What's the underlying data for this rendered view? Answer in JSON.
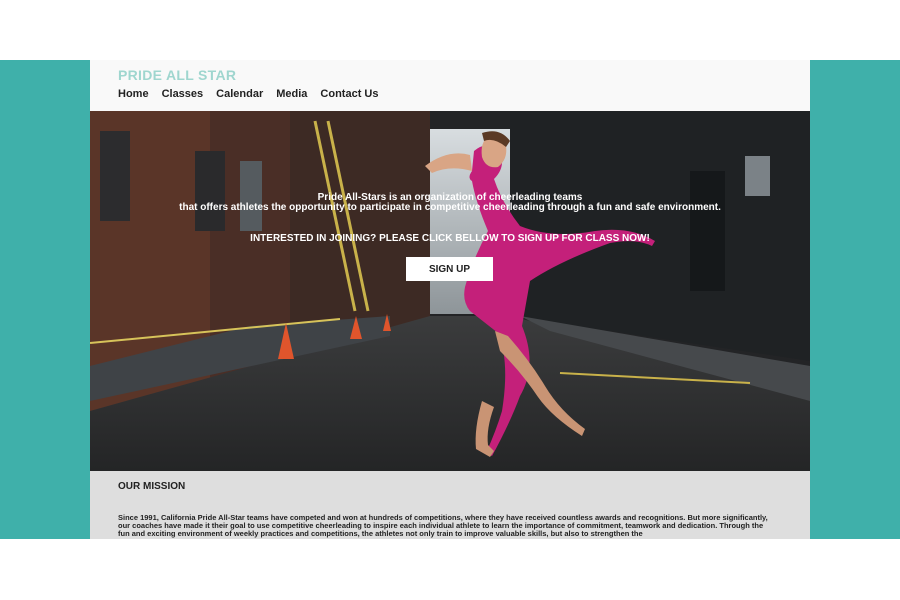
{
  "brand": "PRIDE ALL STAR",
  "nav": [
    "Home",
    "Classes",
    "Calendar",
    "Media",
    "Contact Us"
  ],
  "hero": {
    "line1": "Pride All-Stars is an organization of cheerleading teams",
    "line2": "that offers athletes the opportunity to participate in competitive cheerleading through a fun and safe environment.",
    "cta": "INTERESTED IN JOINING? PLEASE CLICK BELLOW TO SIGN UP FOR CLASS NOW!",
    "button": "SIGN UP"
  },
  "mission": {
    "title": "OUR MISSION",
    "body": "Since 1991, California Pride All-Star teams have competed and won at hundreds of competitions, where they have received countless awards and recognitions. But more significantly, our coaches have made it their goal to use competitive cheerleading to inspire each individual athlete to learn the importance of commitment, teamwork and dedication. Through the fun and exciting environment of weekly practices and competitions, the athletes not only train to improve valuable skills, but also to strengthen the"
  },
  "colors": {
    "teal": "#3fb0aa",
    "brand_text": "#9fd6cf",
    "mission_bg": "#dedede",
    "leotard": "#c4207a"
  }
}
